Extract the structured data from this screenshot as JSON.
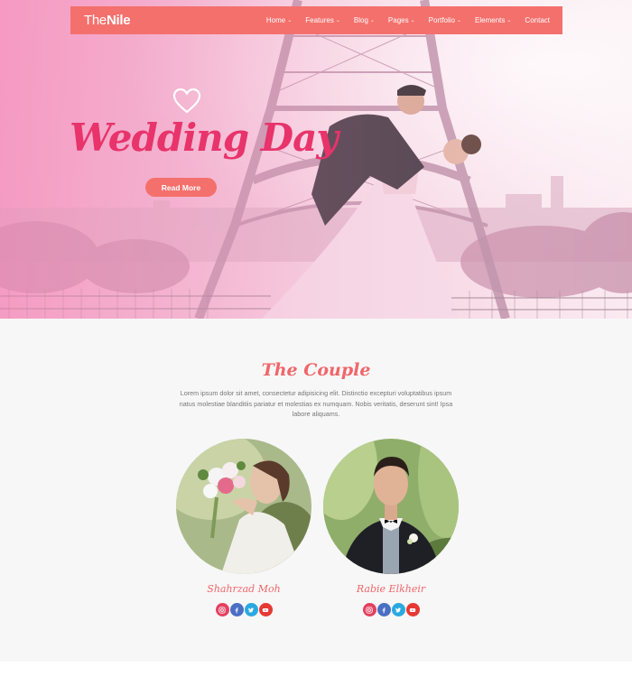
{
  "brand": {
    "logo_light": "The",
    "logo_bold": "Nile"
  },
  "nav": {
    "items": [
      {
        "label": "Home",
        "dropdown": true
      },
      {
        "label": "Features",
        "dropdown": true
      },
      {
        "label": "Blog",
        "dropdown": true
      },
      {
        "label": "Pages",
        "dropdown": true
      },
      {
        "label": "Portfolio",
        "dropdown": true
      },
      {
        "label": "Elements",
        "dropdown": true
      },
      {
        "label": "Contact",
        "dropdown": false
      }
    ]
  },
  "hero": {
    "title": "Wedding Day",
    "button_label": "Read More",
    "icon": "heart-icon"
  },
  "couple": {
    "title": "The Couple",
    "description": "Lorem ipsum dolor sit amet, consectetur adipisicing elit. Distinctio excepturi voluptatibus ipsum natus molestiae blanditiis pariatur et molestias ex numquam. Nobis veritatis, deserunt sint! Ipsa labore aliquams.",
    "people": [
      {
        "name": "Shahrzad Moh",
        "role": "bride"
      },
      {
        "name": "Rabie Elkheir",
        "role": "groom"
      }
    ],
    "social_icons": [
      "instagram-icon",
      "facebook-icon",
      "twitter-icon",
      "youtube-icon"
    ]
  },
  "colors": {
    "accent": "#f4706c",
    "hero_title": "#e8336b",
    "instagram": "#e4405f",
    "facebook": "#4a6fc4",
    "twitter": "#2aa9e0",
    "youtube": "#e53935"
  }
}
